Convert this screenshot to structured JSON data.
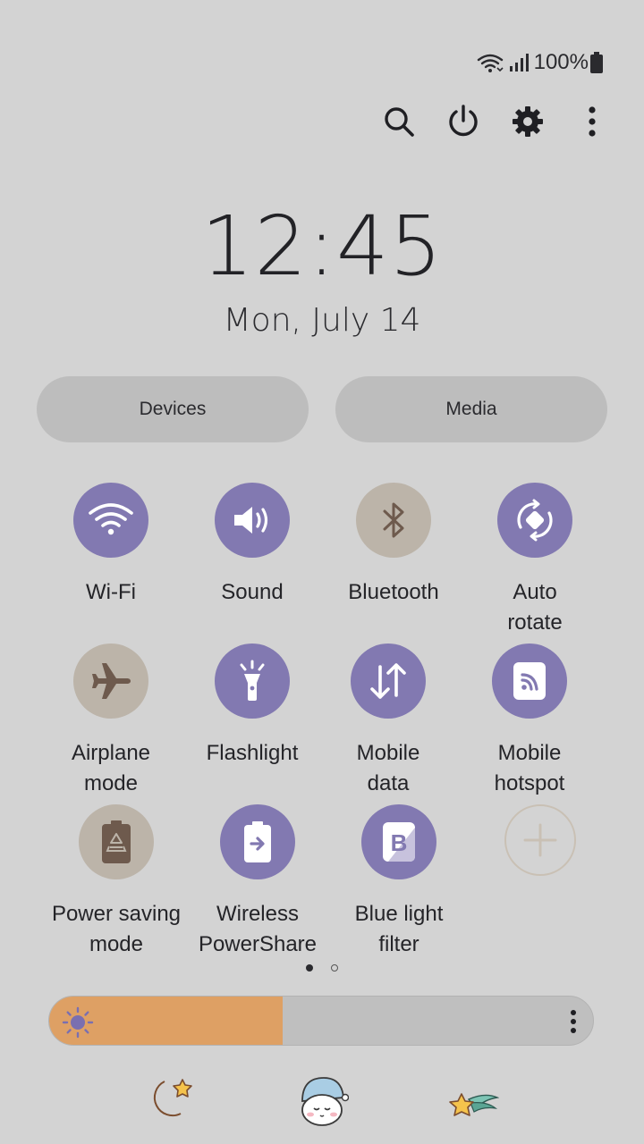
{
  "status": {
    "battery_text": "100%"
  },
  "clock": {
    "time": "12:45",
    "date": "Mon, July 14"
  },
  "panels": {
    "devices": "Devices",
    "media": "Media"
  },
  "tiles": [
    {
      "label": "Wi-Fi",
      "icon": "wifi-icon",
      "state": "on"
    },
    {
      "label": "Sound",
      "icon": "speaker-icon",
      "state": "on"
    },
    {
      "label": "Bluetooth",
      "icon": "bluetooth-icon",
      "state": "off"
    },
    {
      "label": "Auto\nrotate",
      "icon": "rotate-icon",
      "state": "on"
    },
    {
      "label": "Airplane\nmode",
      "icon": "airplane-icon",
      "state": "off"
    },
    {
      "label": "Flashlight",
      "icon": "flashlight-icon",
      "state": "on"
    },
    {
      "label": "Mobile\ndata",
      "icon": "mobile-data-icon",
      "state": "on"
    },
    {
      "label": "Mobile\nhotspot",
      "icon": "hotspot-icon",
      "state": "on"
    },
    {
      "label": "Power saving\nmode",
      "icon": "battery-recycle-icon",
      "state": "off"
    },
    {
      "label": "Wireless\nPowerShare",
      "icon": "powershare-icon",
      "state": "on"
    },
    {
      "label": "Blue light\nfilter",
      "icon": "blue-light-icon",
      "state": "on"
    },
    {
      "label": "",
      "icon": "add-icon",
      "state": "add"
    }
  ],
  "pager": {
    "pages": 2,
    "current": 1
  },
  "brightness": {
    "level": 0.43
  },
  "colors": {
    "accent": "#8279b1",
    "off": "#bcb4a9",
    "brightness_fill": "#dea064",
    "background": "#d3d3d3"
  }
}
